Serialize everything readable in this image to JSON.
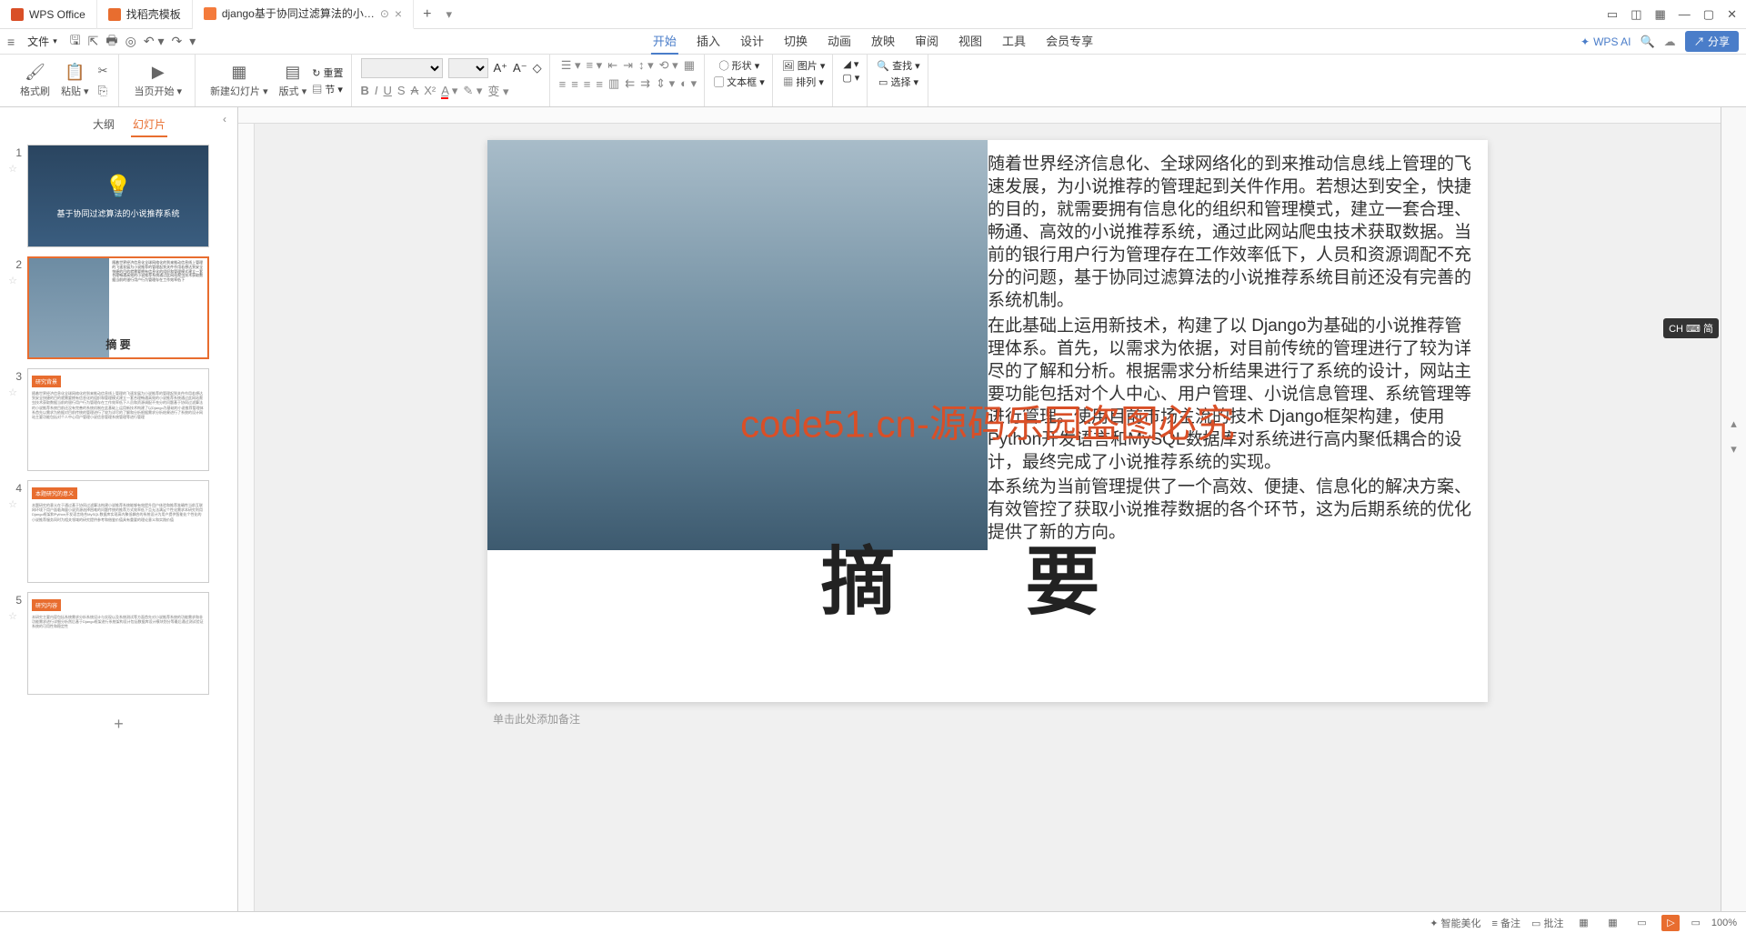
{
  "titlebar": {
    "tabs": [
      {
        "label": "WPS Office",
        "icon": "wps"
      },
      {
        "label": "找稻壳模板",
        "icon": "template"
      },
      {
        "label": "django基于协同过滤算法的小…",
        "icon": "ppt",
        "active": true
      }
    ]
  },
  "menubar": {
    "file_label": "文件",
    "tabs": [
      "开始",
      "插入",
      "设计",
      "切换",
      "动画",
      "放映",
      "审阅",
      "视图",
      "工具",
      "会员专享"
    ],
    "active_tab": "开始",
    "wps_ai": "WPS AI",
    "share": "分享"
  },
  "ribbon": {
    "format_brush": "格式刷",
    "paste": "粘贴",
    "start_from": "当页开始",
    "new_slide": "新建幻灯片",
    "layout": "版式",
    "section": "节",
    "reset": "重置",
    "shape": "形状",
    "textbox": "文本框",
    "picture": "图片",
    "arrange": "排列",
    "find": "查找",
    "select": "选择"
  },
  "panel": {
    "tabs": [
      "大纲",
      "幻灯片"
    ],
    "active": "幻灯片"
  },
  "slides": [
    {
      "num": "1",
      "title": "基于协同过滤算法的小说推荐系统"
    },
    {
      "num": "2",
      "title": "摘    要"
    },
    {
      "num": "3",
      "header": "研究背景"
    },
    {
      "num": "4",
      "header": "本题研究的意义"
    },
    {
      "num": "5",
      "header": "研究内容"
    }
  ],
  "current_slide": {
    "paragraphs": [
      "        随着世界经济信息化、全球网络化的到来推动信息线上管理的飞速发展，为小说推荐的管理起到关件作用。若想达到安全，快捷的目的，就需要拥有信息化的组织和管理模式，建立一套合理、畅通、高效的小说推荐系统，通过此网站爬虫技术获取数据。当前的银行用户行为管理存在工作效率低下，人员和资源调配不充分的问题，基于协同过滤算法的小说推荐系统目前还没有完善的系统机制。",
      "在此基础上运用新技术，构建了以 Django为基础的小说推荐管理体系。首先，以需求为依据，对目前传统的管理进行了较为详尽的了解和分析。根据需求分析结果进行了系统的设计，网站主要功能包括对个人中心、用户管理、小说信息管理、系统管理等进行管理。使用目前市场主流的技术 Django框架构建，使用Python开发语言和MySQL数据库对系统进行高内聚低耦合的设计，最终完成了小说推荐系统的实现。",
      "        本系统为当前管理提供了一个高效、便捷、信息化的解决方案、有效管控了获取小说推荐数据的各个环节，这为后期系统的优化提供了新的方向。"
    ],
    "title": "摘    要",
    "watermark": "code51.cn-源码乐园盗图必究"
  },
  "notes_placeholder": "单击此处添加备注",
  "ime": "CH ⌨ 简",
  "statusbar": {
    "beautify": "智能美化",
    "notes": "备注",
    "comments": "批注",
    "zoom": "100%"
  }
}
